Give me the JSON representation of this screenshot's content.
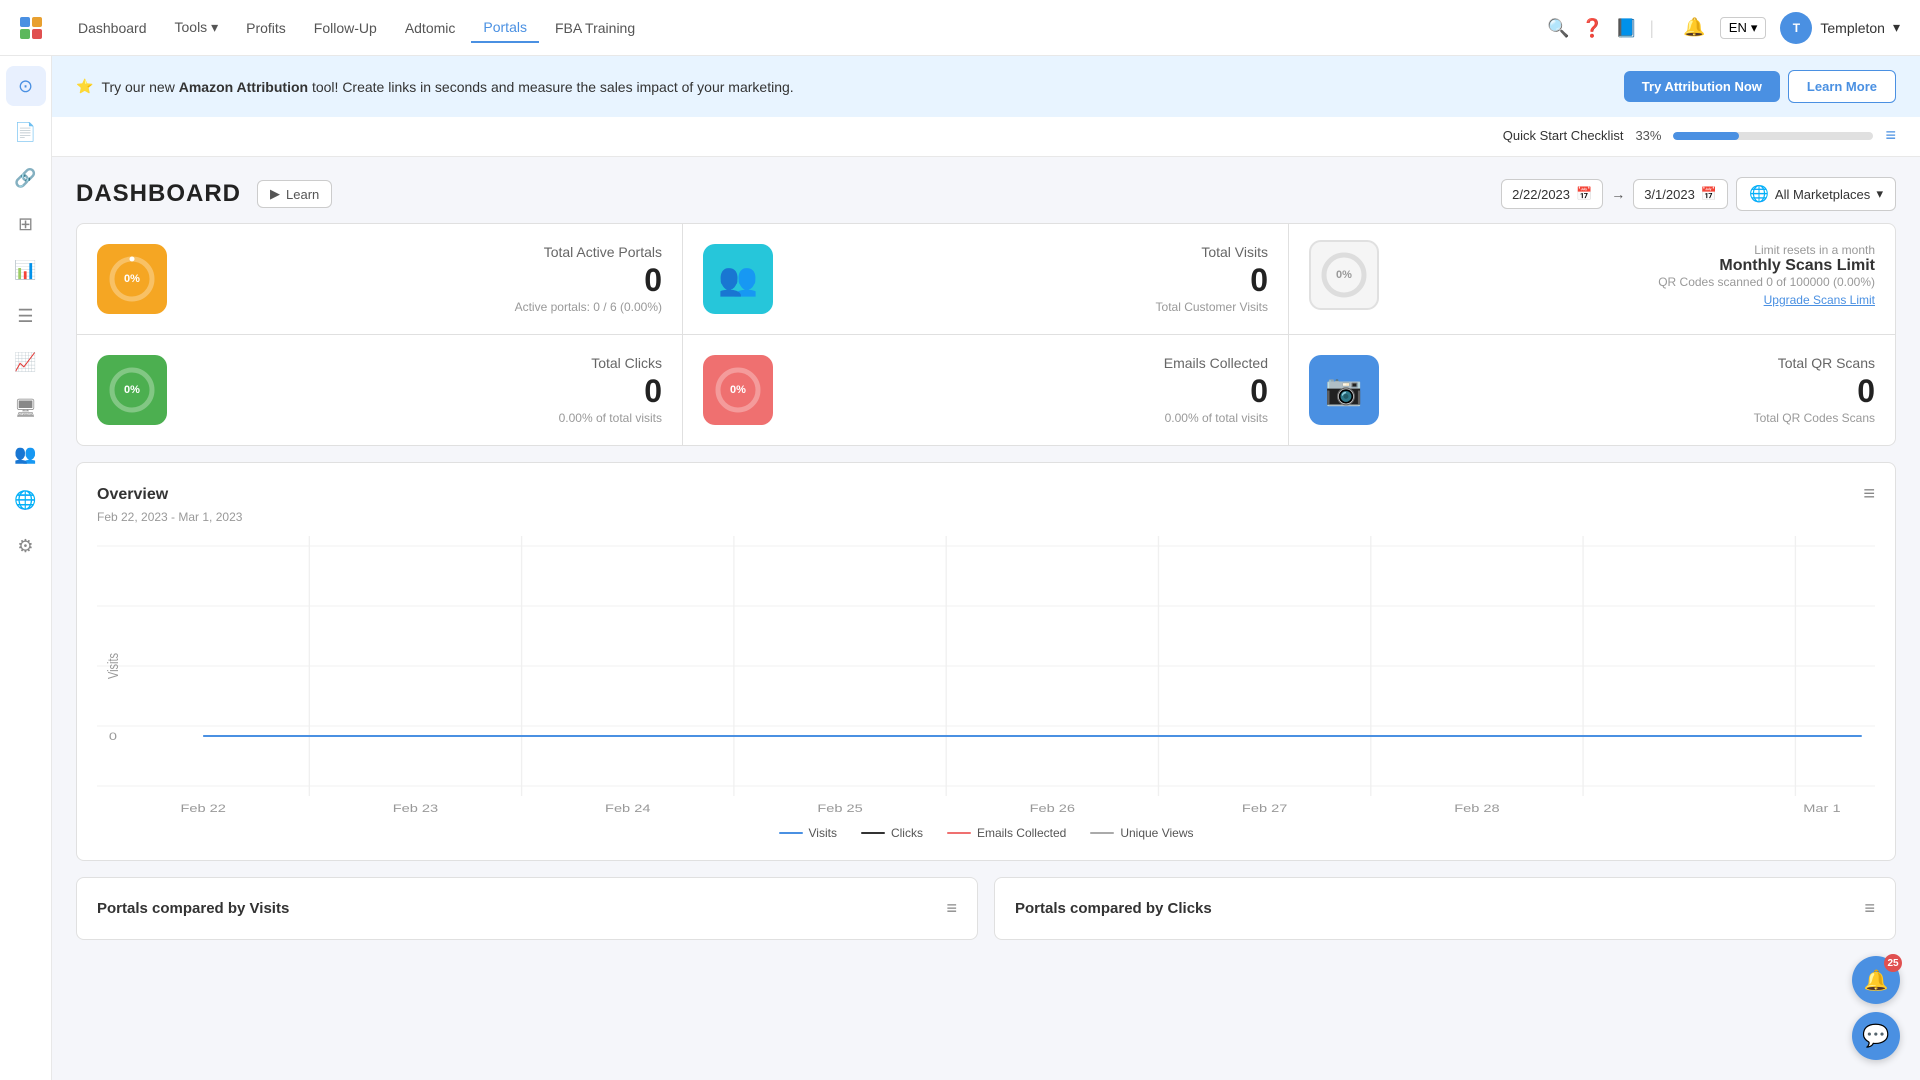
{
  "nav": {
    "links": [
      "Dashboard",
      "Tools",
      "Profits",
      "Follow-Up",
      "Adtomic",
      "Portals",
      "FBA Training"
    ],
    "active": "Portals",
    "tools_has_dropdown": true,
    "lang": "EN",
    "user": "Templeton"
  },
  "banner": {
    "star": "⭐",
    "prefix_text": "Try our new ",
    "brand_text": "Amazon Attribution",
    "suffix_text": " tool! Create links in seconds and measure the sales impact of your marketing.",
    "cta_button": "Try Attribution Now",
    "learn_button": "Learn More"
  },
  "quick_start": {
    "label": "Quick Start Checklist",
    "percent": 33,
    "percent_label": "33%"
  },
  "dashboard": {
    "title": "DASHBOARD",
    "learn_label": "Learn",
    "date_from": "2/22/2023",
    "date_to": "3/1/2023",
    "marketplace": "All Marketplaces"
  },
  "stats": [
    {
      "id": "active-portals",
      "icon_type": "donut",
      "icon_color": "orange",
      "pct": "0%",
      "title": "Total Active Portals",
      "value": "0",
      "sub": "Active portals: 0 / 6 (0.00%)"
    },
    {
      "id": "total-visits",
      "icon_type": "people",
      "icon_color": "teal",
      "title": "Total Visits",
      "value": "0",
      "sub": "Total Customer Visits"
    },
    {
      "id": "monthly-scans",
      "icon_type": "donut-gray",
      "pct": "0%",
      "limit_text": "Limit resets in a month",
      "heading": "Monthly Scans Limit",
      "sub": "QR Codes scanned 0 of 100000 (0.00%)",
      "upgrade_link": "Upgrade Scans Limit"
    },
    {
      "id": "total-clicks",
      "icon_type": "donut",
      "icon_color": "green",
      "pct": "0%",
      "title": "Total Clicks",
      "value": "0",
      "sub": "0.00% of total visits"
    },
    {
      "id": "emails-collected",
      "icon_type": "donut",
      "icon_color": "salmon",
      "pct": "0%",
      "title": "Emails Collected",
      "value": "0",
      "sub": "0.00% of total visits"
    },
    {
      "id": "total-qr-scans",
      "icon_type": "camera",
      "icon_color": "blue",
      "title": "Total QR Scans",
      "value": "0",
      "sub": "Total QR Codes Scans"
    }
  ],
  "chart": {
    "title": "Overview",
    "date_range": "Feb 22, 2023 - Mar 1, 2023",
    "y_label": "Visits",
    "y_value": "0",
    "x_labels": [
      "Feb 22",
      "Feb 23",
      "Feb 24",
      "Feb 25",
      "Feb 26",
      "Feb 27",
      "Feb 28",
      "Mar 1"
    ],
    "legend": [
      {
        "label": "Visits",
        "color": "#4a90e2"
      },
      {
        "label": "Clicks",
        "color": "#333"
      },
      {
        "label": "Emails Collected",
        "color": "#ef7070"
      },
      {
        "label": "Unique Views",
        "color": "#aaa"
      }
    ]
  },
  "bottom_cards": [
    {
      "title": "Portals compared by Visits"
    },
    {
      "title": "Portals compared by Clicks"
    }
  ],
  "floating": {
    "notification_count": "25",
    "chat_icon": "💬"
  }
}
